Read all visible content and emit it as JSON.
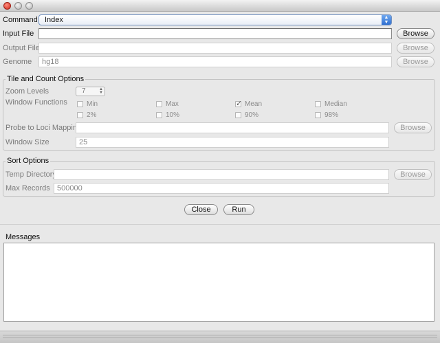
{
  "window": {
    "controls": [
      "close",
      "minimize",
      "maximize"
    ]
  },
  "command": {
    "label": "Command",
    "value": "Index"
  },
  "input_file": {
    "label": "Input File",
    "value": "",
    "browse": "Browse"
  },
  "output_file": {
    "label": "Output File",
    "value": "",
    "browse": "Browse"
  },
  "genome": {
    "label": "Genome",
    "value": "hg18",
    "browse": "Browse"
  },
  "tile": {
    "title": "Tile and Count Options",
    "zoom_label": "Zoom Levels",
    "zoom_value": "7",
    "window_functions_label": "Window Functions",
    "functions": [
      {
        "label": "Min",
        "checked": false
      },
      {
        "label": "Max",
        "checked": false
      },
      {
        "label": "Mean",
        "checked": true
      },
      {
        "label": "Median",
        "checked": false
      },
      {
        "label": "2%",
        "checked": false
      },
      {
        "label": "10%",
        "checked": false
      },
      {
        "label": "90%",
        "checked": false
      },
      {
        "label": "98%",
        "checked": false
      }
    ],
    "probe_label": "Probe to Loci Mapping",
    "probe_value": "",
    "probe_browse": "Browse",
    "window_size_label": "Window Size",
    "window_size_value": "25"
  },
  "sort": {
    "title": "Sort Options",
    "temp_label": "Temp Directory",
    "temp_value": "",
    "temp_browse": "Browse",
    "max_label": "Max Records",
    "max_value": "500000"
  },
  "actions": {
    "close": "Close",
    "run": "Run"
  },
  "messages": {
    "label": "Messages",
    "content": ""
  }
}
